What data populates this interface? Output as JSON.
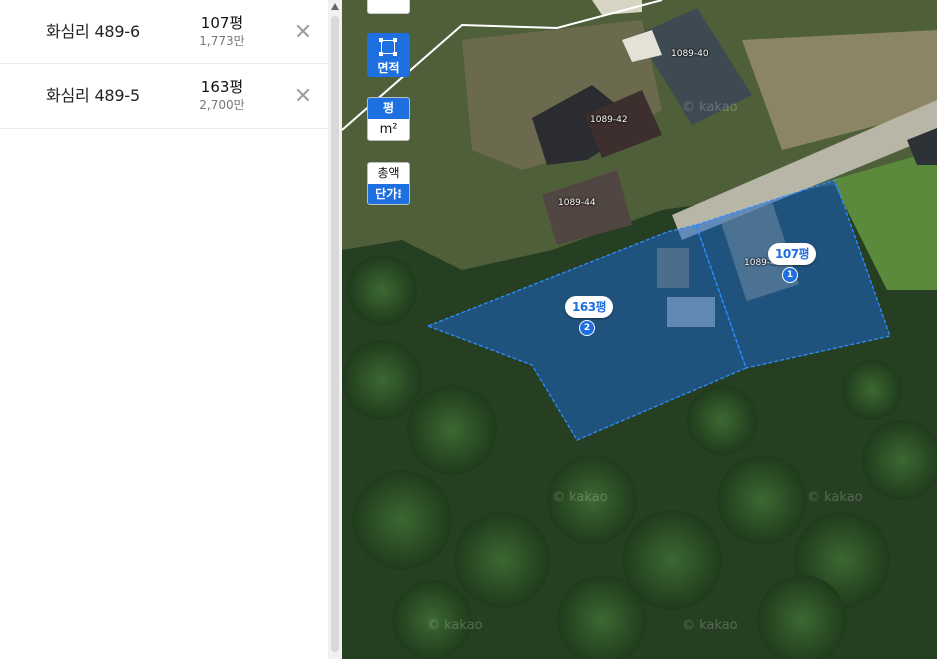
{
  "parcels": [
    {
      "name": "화심리 489-6",
      "area": "107평",
      "price": "1,773만",
      "marker": "1"
    },
    {
      "name": "화심리 489-5",
      "area": "163평",
      "price": "2,700만",
      "marker": "2"
    }
  ],
  "map": {
    "controls": {
      "area_label": "면적",
      "unit_pyeong": "평",
      "unit_m2": "m²",
      "price_total": "총액",
      "price_unit": "단가⁝"
    },
    "lot_labels": [
      "1089-40",
      "1089-42",
      "1089-44",
      "1089-4"
    ],
    "watermark": "© kakao",
    "colors": {
      "accent": "#1e6fe0",
      "selection_fill": "#1a64c8",
      "selection_stroke": "#2f8cff"
    }
  }
}
